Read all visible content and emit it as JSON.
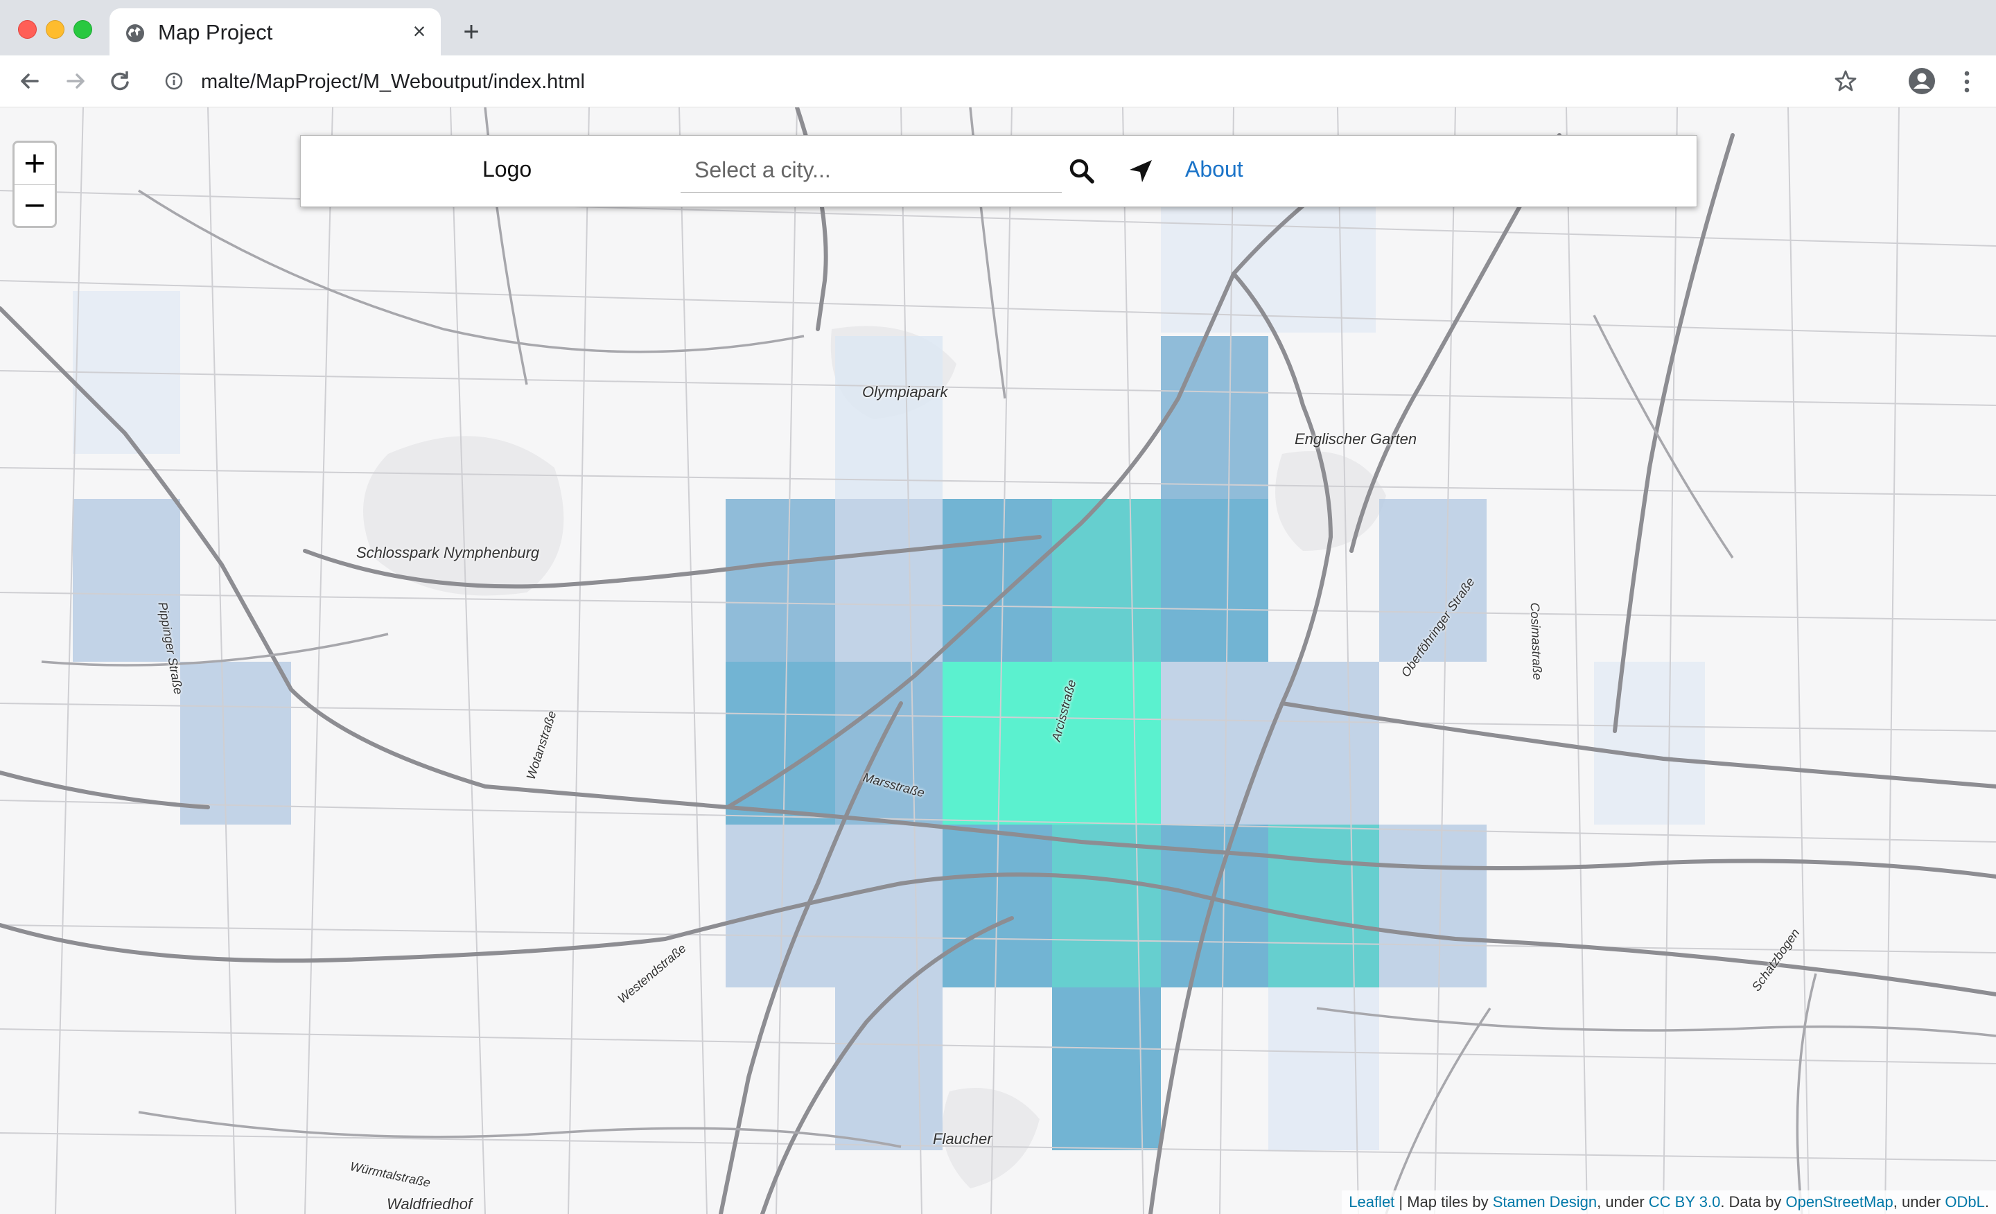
{
  "browser": {
    "tab_title": "Map Project",
    "close_glyph": "×",
    "new_tab_glyph": "+",
    "url": "malte/MapProject/M_Weboutput/index.html"
  },
  "map": {
    "zoom_in": "+",
    "zoom_out": "−",
    "navbar": {
      "logo": "Logo",
      "search_placeholder": "Select a city...",
      "about": "About"
    },
    "place_labels": {
      "olympiapark": "Olympiapark",
      "englischer_garten": "Englischer Garten",
      "schlosspark": "Schlosspark Nymphenburg",
      "flaucher": "Flaucher",
      "waldfriedhof": "Waldfriedhof",
      "pippinger": "Pippinger Straße",
      "wotanstrasse": "Wotanstraße",
      "marsstrasse": "Marsstraße",
      "westendstrasse": "Westendstraße",
      "wurmtalstrasse": "Würmtalstraße",
      "arcisstrasse": "Arcisstraße",
      "oberfohringer": "Oberföhringer Straße",
      "cosimastrasse": "Cosimastraße",
      "schatzbogen": "Schatzbogen"
    },
    "heatmap_colors": {
      "faint": "#dde7f3",
      "light": "#b9cde4",
      "mid": "#7eb2d3",
      "strong": "#5aa8cc",
      "teal": "#4cc8c8",
      "hot": "#3ff0c8"
    },
    "attribution": {
      "leaflet": "Leaflet",
      "tiles_prefix": " | Map tiles by ",
      "stamen": "Stamen Design",
      "under1": ", under ",
      "cc": "CC BY 3.0",
      "data_by": ". Data by ",
      "osm": "OpenStreetMap",
      "under2": ", under ",
      "odbl": "ODbL",
      "end": "."
    }
  }
}
